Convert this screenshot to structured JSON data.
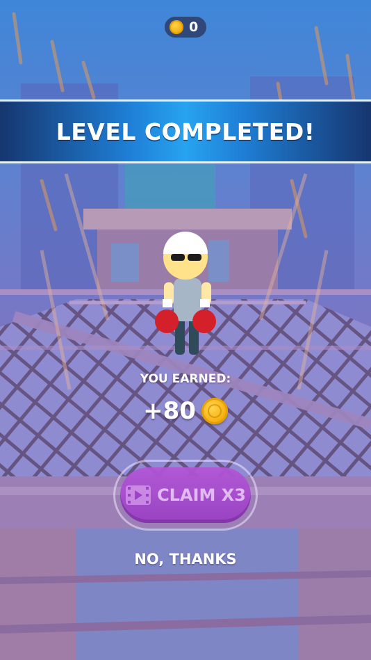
{
  "hud": {
    "coin_count": "0",
    "coin_icon": "coin-icon"
  },
  "banner": {
    "title": "LEVEL COMPLETED!"
  },
  "reward": {
    "label": "YOU EARNED:",
    "amount": "+80",
    "coin_icon": "coin-icon"
  },
  "claim_button": {
    "label": "CLAIM X3",
    "icon": "video-icon"
  },
  "no_thanks": {
    "label": "NO, THANKS"
  },
  "colors": {
    "banner": "#1f7fd6",
    "claim_button": "#a94bd2",
    "coin": "#f5b010"
  }
}
